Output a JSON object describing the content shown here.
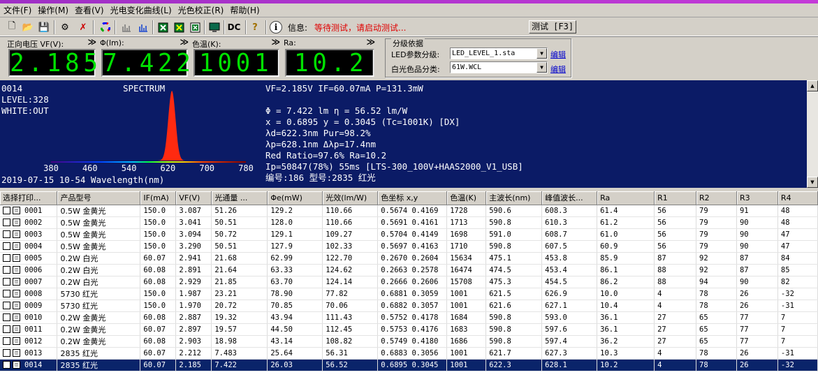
{
  "menu": [
    "文件(F)",
    "操作(M)",
    "查看(V)",
    "光电变化曲线(L)",
    "光色校正(R)",
    "帮助(H)"
  ],
  "toolbar": {
    "info_label": "信息:",
    "info_message": "等待测试，请启动测试...",
    "dc_label": "DC",
    "test_button": "测试 [F3]",
    "icons": [
      "new-icon",
      "open-icon",
      "save-icon",
      "settings-icon",
      "clear-icon",
      "color-wheel-icon",
      "chart-icon",
      "chart-blue-icon",
      "report-green-icon",
      "report-yellow-icon",
      "report-excel-icon",
      "monitor-icon",
      "dc-icon",
      "help-icon",
      "info-icon"
    ]
  },
  "meters": [
    {
      "label": "正向电压 VF(V):",
      "value": "2.185"
    },
    {
      "label": "Φ(lm):",
      "value": "7.422"
    },
    {
      "label": "色温(K):",
      "value": "1001"
    },
    {
      "label": "Ra:",
      "value": "10.2"
    }
  ],
  "meter_arrow": "≫",
  "grading": {
    "title": "分级依据",
    "led_label": "LED参数分级:",
    "led_value": "LED_LEVEL_1.sta",
    "white_label": "白光色品分类:",
    "white_value": "61W.WCL",
    "edit_label": "编辑"
  },
  "spectrum": {
    "id": "0014",
    "title": "SPECTRUM",
    "level": "LEVEL:328",
    "white": "WHITE:OUT",
    "x_ticks": [
      "380",
      "460",
      "540",
      "620",
      "700",
      "780"
    ],
    "footer": "2019-07-15 10-54 Wavelength(nm)",
    "peak_color": "#ff2a10",
    "lines": [
      "VF=2.185V  IF=60.07mA  P=131.3mW",
      "",
      "Φ = 7.422 lm    η = 56.52 lm/W",
      "x = 0.6895 y = 0.3045 (Tc=1001K) [DX]",
      "λd=622.3nm Pur=98.2%",
      "λp=628.1nm Δλp=17.4nm",
      "Red Ratio=97.6%  Ra=10.2",
      "Ip=50847(78%) 55ms  [LTS-300_100V+HAAS2000_V1_USB]",
      "编号:186 型号:2835 红光"
    ]
  },
  "table": {
    "headers": [
      "选择打印...",
      "产品型号",
      "IF(mA)",
      "VF(V)",
      "光通量 ...",
      "Φe(mW)",
      "光效(lm/W)",
      "色坐标 x,y",
      "色温(K)",
      "主波长(nm)",
      "峰值波长...",
      "Ra",
      "R1",
      "R2",
      "R3",
      "R4"
    ],
    "rows": [
      [
        "0001",
        "0.5W 金黄光",
        "150.0",
        "3.087",
        "51.26",
        "129.2",
        "110.66",
        "0.5674 0.4169",
        "1728",
        "590.6",
        "608.3",
        "61.4",
        "56",
        "79",
        "91",
        "48"
      ],
      [
        "0002",
        "0.5W 金黄光",
        "150.0",
        "3.041",
        "50.51",
        "128.0",
        "110.66",
        "0.5691 0.4161",
        "1713",
        "590.8",
        "610.3",
        "61.2",
        "56",
        "79",
        "90",
        "48"
      ],
      [
        "0003",
        "0.5W 金黄光",
        "150.0",
        "3.094",
        "50.72",
        "129.1",
        "109.27",
        "0.5704 0.4149",
        "1698",
        "591.0",
        "608.7",
        "61.0",
        "56",
        "79",
        "90",
        "47"
      ],
      [
        "0004",
        "0.5W 金黄光",
        "150.0",
        "3.290",
        "50.51",
        "127.9",
        "102.33",
        "0.5697 0.4163",
        "1710",
        "590.8",
        "607.5",
        "60.9",
        "56",
        "79",
        "90",
        "47"
      ],
      [
        "0005",
        "0.2W 白光",
        "60.07",
        "2.941",
        "21.68",
        "62.99",
        "122.70",
        "0.2670 0.2604",
        "15634",
        "475.1",
        "453.8",
        "85.9",
        "87",
        "92",
        "87",
        "84"
      ],
      [
        "0006",
        "0.2W 白光",
        "60.08",
        "2.891",
        "21.64",
        "63.33",
        "124.62",
        "0.2663 0.2578",
        "16474",
        "474.5",
        "453.4",
        "86.1",
        "88",
        "92",
        "87",
        "85"
      ],
      [
        "0007",
        "0.2W 白光",
        "60.08",
        "2.929",
        "21.85",
        "63.70",
        "124.14",
        "0.2666 0.2606",
        "15708",
        "475.3",
        "454.5",
        "86.2",
        "88",
        "94",
        "90",
        "82"
      ],
      [
        "0008",
        "5730 红光",
        "150.0",
        "1.987",
        "23.21",
        "78.90",
        "77.82",
        "0.6881 0.3059",
        "1001",
        "621.5",
        "626.9",
        "10.0",
        "4",
        "78",
        "26",
        "-32"
      ],
      [
        "0009",
        "5730 红光",
        "150.0",
        "1.970",
        "20.72",
        "70.85",
        "70.06",
        "0.6882 0.3057",
        "1001",
        "621.6",
        "627.1",
        "10.4",
        "4",
        "78",
        "26",
        "-31"
      ],
      [
        "0010",
        "0.2W  金黄光",
        "60.08",
        "2.887",
        "19.32",
        "43.94",
        "111.43",
        "0.5752 0.4178",
        "1684",
        "590.8",
        "593.0",
        "36.1",
        "27",
        "65",
        "77",
        "7"
      ],
      [
        "0011",
        "0.2W  金黄光",
        "60.07",
        "2.897",
        "19.57",
        "44.50",
        "112.45",
        "0.5753 0.4176",
        "1683",
        "590.8",
        "597.6",
        "36.1",
        "27",
        "65",
        "77",
        "7"
      ],
      [
        "0012",
        "0.2W  金黄光",
        "60.08",
        "2.903",
        "18.98",
        "43.14",
        "108.82",
        "0.5749 0.4180",
        "1686",
        "590.8",
        "597.4",
        "36.2",
        "27",
        "65",
        "77",
        "7"
      ],
      [
        "0013",
        "2835 红光",
        "60.07",
        "2.212",
        "7.483",
        "25.64",
        "56.31",
        "0.6883 0.3056",
        "1001",
        "621.7",
        "627.3",
        "10.3",
        "4",
        "78",
        "26",
        "-31"
      ],
      [
        "0014",
        "2835 红光",
        "60.07",
        "2.185",
        "7.422",
        "26.03",
        "56.52",
        "0.6895 0.3045",
        "1001",
        "622.3",
        "628.1",
        "10.2",
        "4",
        "78",
        "26",
        "-32"
      ]
    ],
    "selected_row": 13
  }
}
